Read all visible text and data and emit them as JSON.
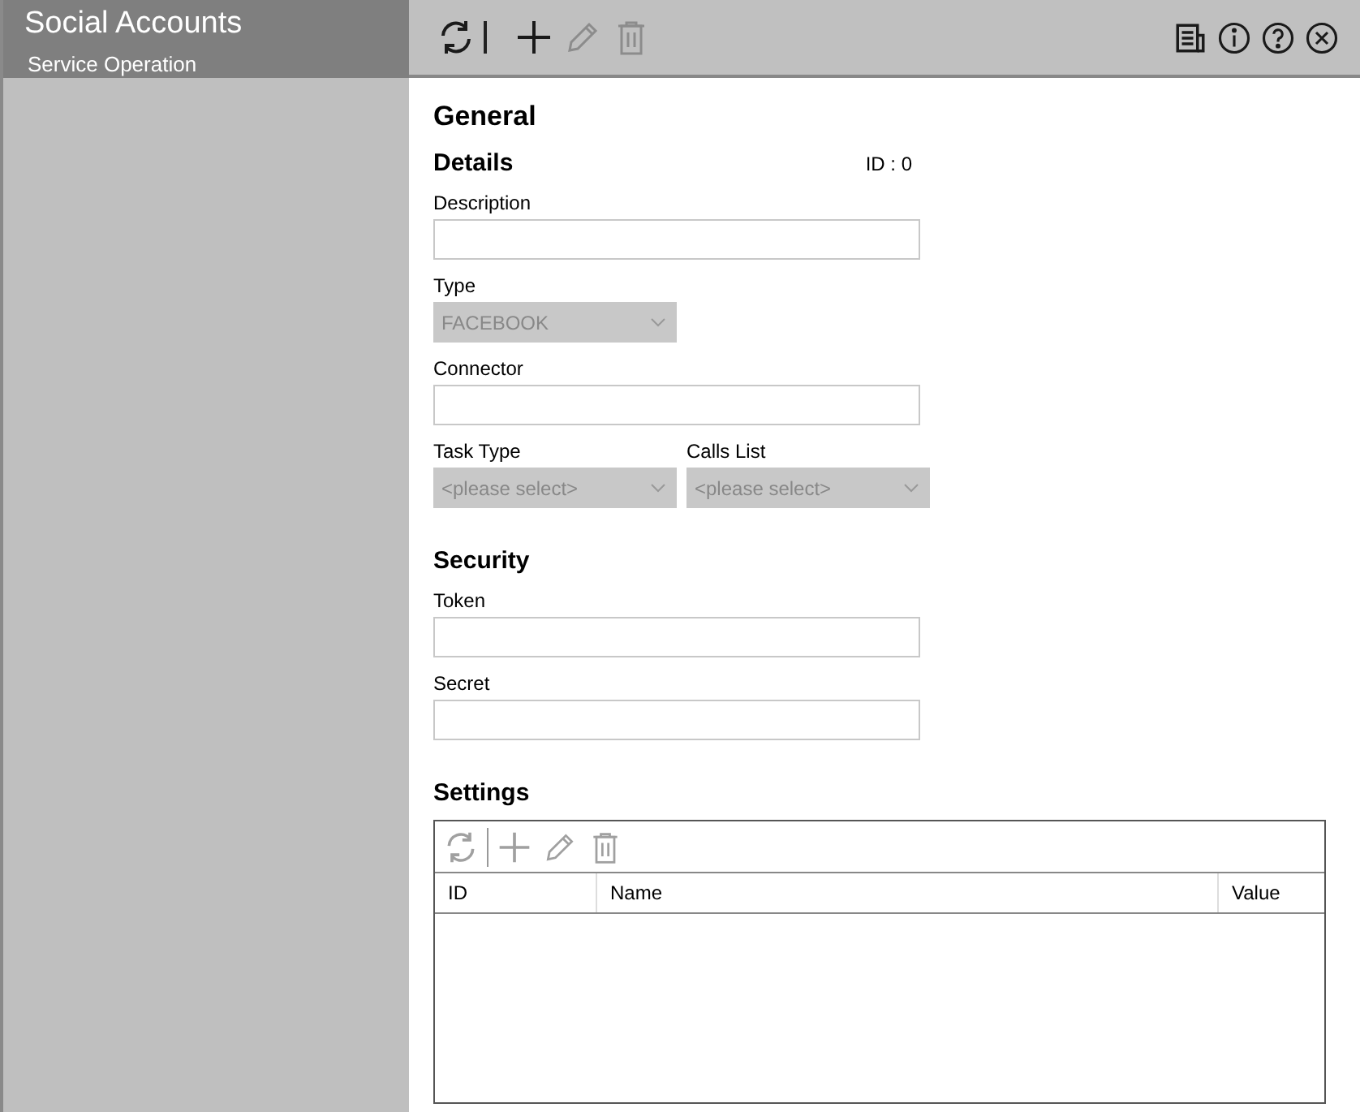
{
  "app": {
    "title": "Social Accounts",
    "subtitle": "Service Operation"
  },
  "toolbar": {
    "left": [
      {
        "kind": "refresh",
        "disabled": false
      },
      {
        "kind": "add",
        "disabled": false
      },
      {
        "kind": "edit",
        "disabled": true
      },
      {
        "kind": "delete",
        "disabled": true
      }
    ],
    "right": [
      {
        "kind": "report"
      },
      {
        "kind": "info"
      },
      {
        "kind": "help"
      },
      {
        "kind": "close"
      }
    ]
  },
  "page_title": "General",
  "sections": [
    {
      "title": "Details",
      "id_label": "ID : 0",
      "rows": [
        [
          {
            "label": "Description",
            "kind": "text",
            "disabled": false
          }
        ],
        [
          {
            "label": "Type",
            "kind": "select",
            "disabled": true,
            "value": "FACEBOOK"
          }
        ],
        [
          {
            "label": "Connector",
            "kind": "text",
            "disabled": false
          }
        ],
        [
          {
            "label": "Task Type",
            "kind": "select",
            "disabled": true,
            "placeholder": "<please select>"
          },
          {
            "label": "Calls List",
            "kind": "select",
            "disabled": true,
            "placeholder": "<please select>"
          }
        ]
      ]
    },
    {
      "title": "Security",
      "rows": [
        [
          {
            "label": "Token",
            "kind": "text",
            "disabled": false
          }
        ],
        [
          {
            "label": "Secret",
            "kind": "text",
            "disabled": false
          }
        ]
      ]
    }
  ],
  "settings": {
    "title": "Settings",
    "toolbar": [
      {
        "kind": "refresh",
        "disabled": true
      },
      {
        "kind": "add",
        "disabled": true
      },
      {
        "kind": "edit",
        "disabled": true
      },
      {
        "kind": "delete",
        "disabled": true
      }
    ],
    "columns": [
      "ID",
      "Name",
      "Value"
    ]
  }
}
